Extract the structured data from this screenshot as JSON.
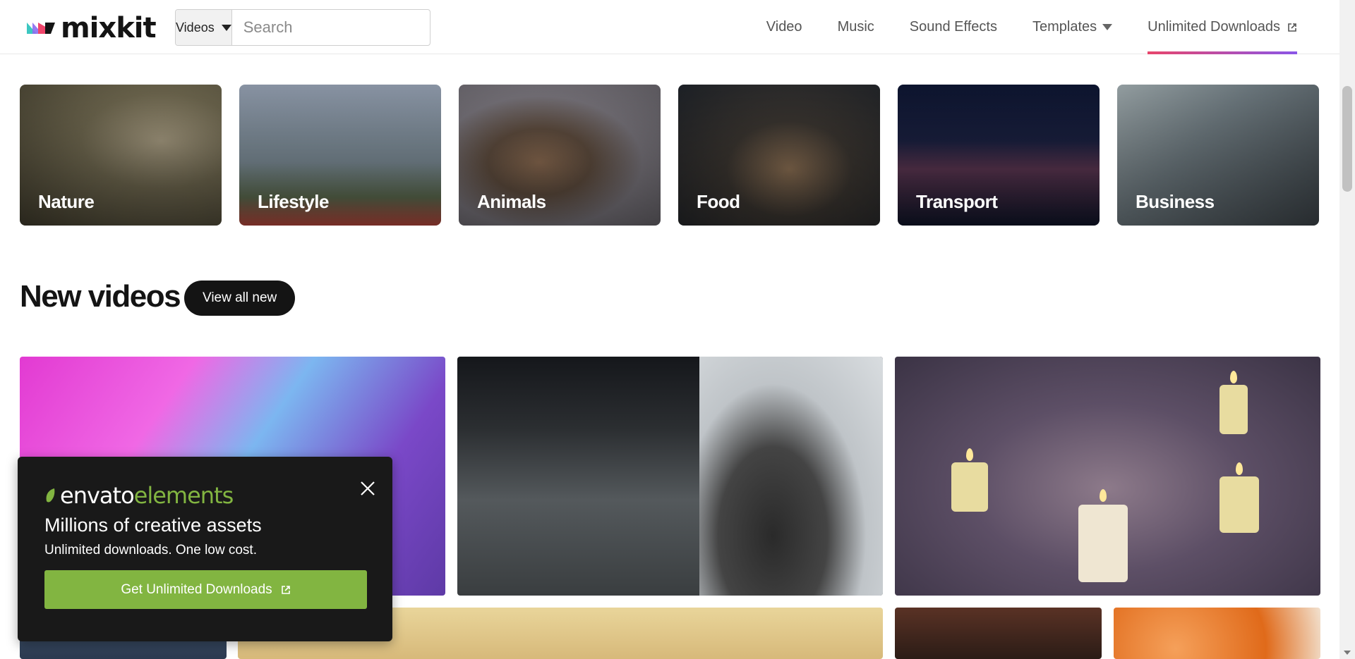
{
  "header": {
    "logo_text": "mixkit",
    "search": {
      "type_label": "Videos",
      "placeholder": "Search"
    },
    "nav": [
      {
        "label": "Video"
      },
      {
        "label": "Music"
      },
      {
        "label": "Sound Effects"
      },
      {
        "label": "Templates"
      },
      {
        "label": "Unlimited Downloads"
      }
    ]
  },
  "categories": [
    {
      "label": "Nature"
    },
    {
      "label": "Lifestyle"
    },
    {
      "label": "Animals"
    },
    {
      "label": "Food"
    },
    {
      "label": "Transport"
    },
    {
      "label": "Business"
    }
  ],
  "new_videos": {
    "title": "New videos",
    "view_all_label": "View all new"
  },
  "popup": {
    "brand_envato": "envato",
    "brand_elements": "elements",
    "title": "Millions of creative assets",
    "subtitle": "Unlimited downloads. One low cost.",
    "cta_label": "Get Unlimited Downloads"
  },
  "colors": {
    "accent_green": "#82b541",
    "dark": "#141414",
    "nav_underline_start": "#e8456b",
    "nav_underline_end": "#8a56e8"
  }
}
